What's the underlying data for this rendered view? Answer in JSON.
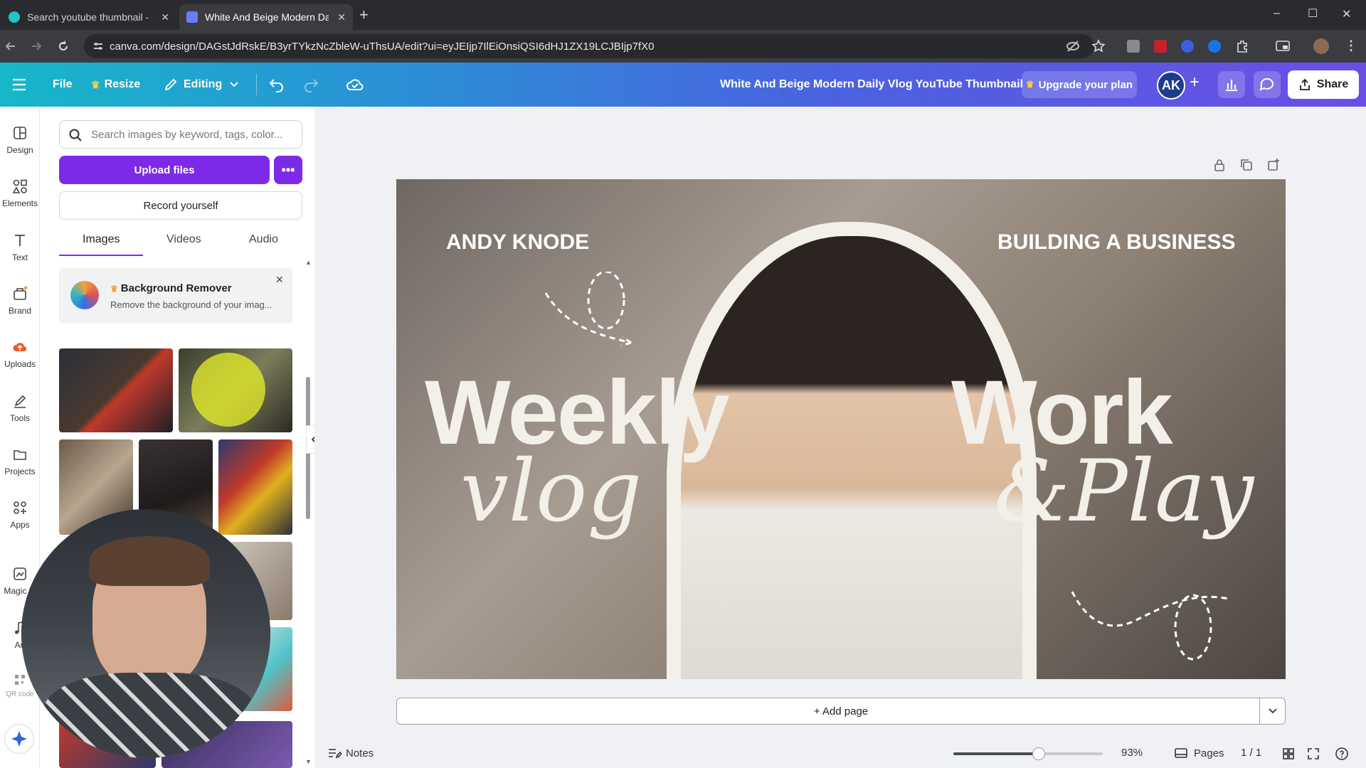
{
  "browser": {
    "tabs": [
      {
        "title": "Search youtube thumbnail - Ca",
        "close": "✕"
      },
      {
        "title": "White And Beige Modern Daily",
        "close": "✕"
      }
    ],
    "new_tab": "+",
    "url": "canva.com/design/DAGstJdRskE/B3yrTYkzNcZbleW-uThsUA/edit?ui=eyJEIjp7IlEiOnsiQSI6dHJ1ZX19LCJBIjp7fX0",
    "window_controls": {
      "minimize": "–",
      "maximize": "☐",
      "close": "✕"
    }
  },
  "topbar": {
    "file": "File",
    "resize": "Resize",
    "editing": "Editing",
    "doc_title": "White And Beige Modern Daily Vlog YouTube Thumbnail",
    "upgrade": "Upgrade your plan",
    "avatar": "AK",
    "share": "Share"
  },
  "rail": {
    "items": [
      "Design",
      "Elements",
      "Text",
      "Brand",
      "Uploads",
      "Tools",
      "Projects",
      "Apps",
      "Magic M",
      "Au",
      "QR code"
    ]
  },
  "panel": {
    "search_placeholder": "Search images by keyword, tags, color...",
    "upload_label": "Upload files",
    "more_label": "•••",
    "record_label": "Record yourself",
    "tabs": [
      "Images",
      "Videos",
      "Audio"
    ],
    "active_tab": "Images",
    "promo": {
      "title": "Background Remover",
      "subtitle": "Remove the background of your imag...",
      "close": "✕"
    }
  },
  "design": {
    "name_left": "ANDY KNODE",
    "name_right": "BUILDING A BUSINESS",
    "word_weekly": "Weekly",
    "word_work": "Work",
    "script_vlog": "vlog",
    "script_play": "&Play"
  },
  "canvas": {
    "add_page": "+ Add page"
  },
  "bottombar": {
    "notes": "Notes",
    "zoom": "93%",
    "zoom_fraction": 0.57,
    "pages_label": "Pages",
    "page_count": "1 / 1"
  },
  "colors": {
    "accent_purple": "#7d2ae8",
    "topbar_start": "#17b7c9",
    "topbar_end": "#6b4ee6"
  }
}
